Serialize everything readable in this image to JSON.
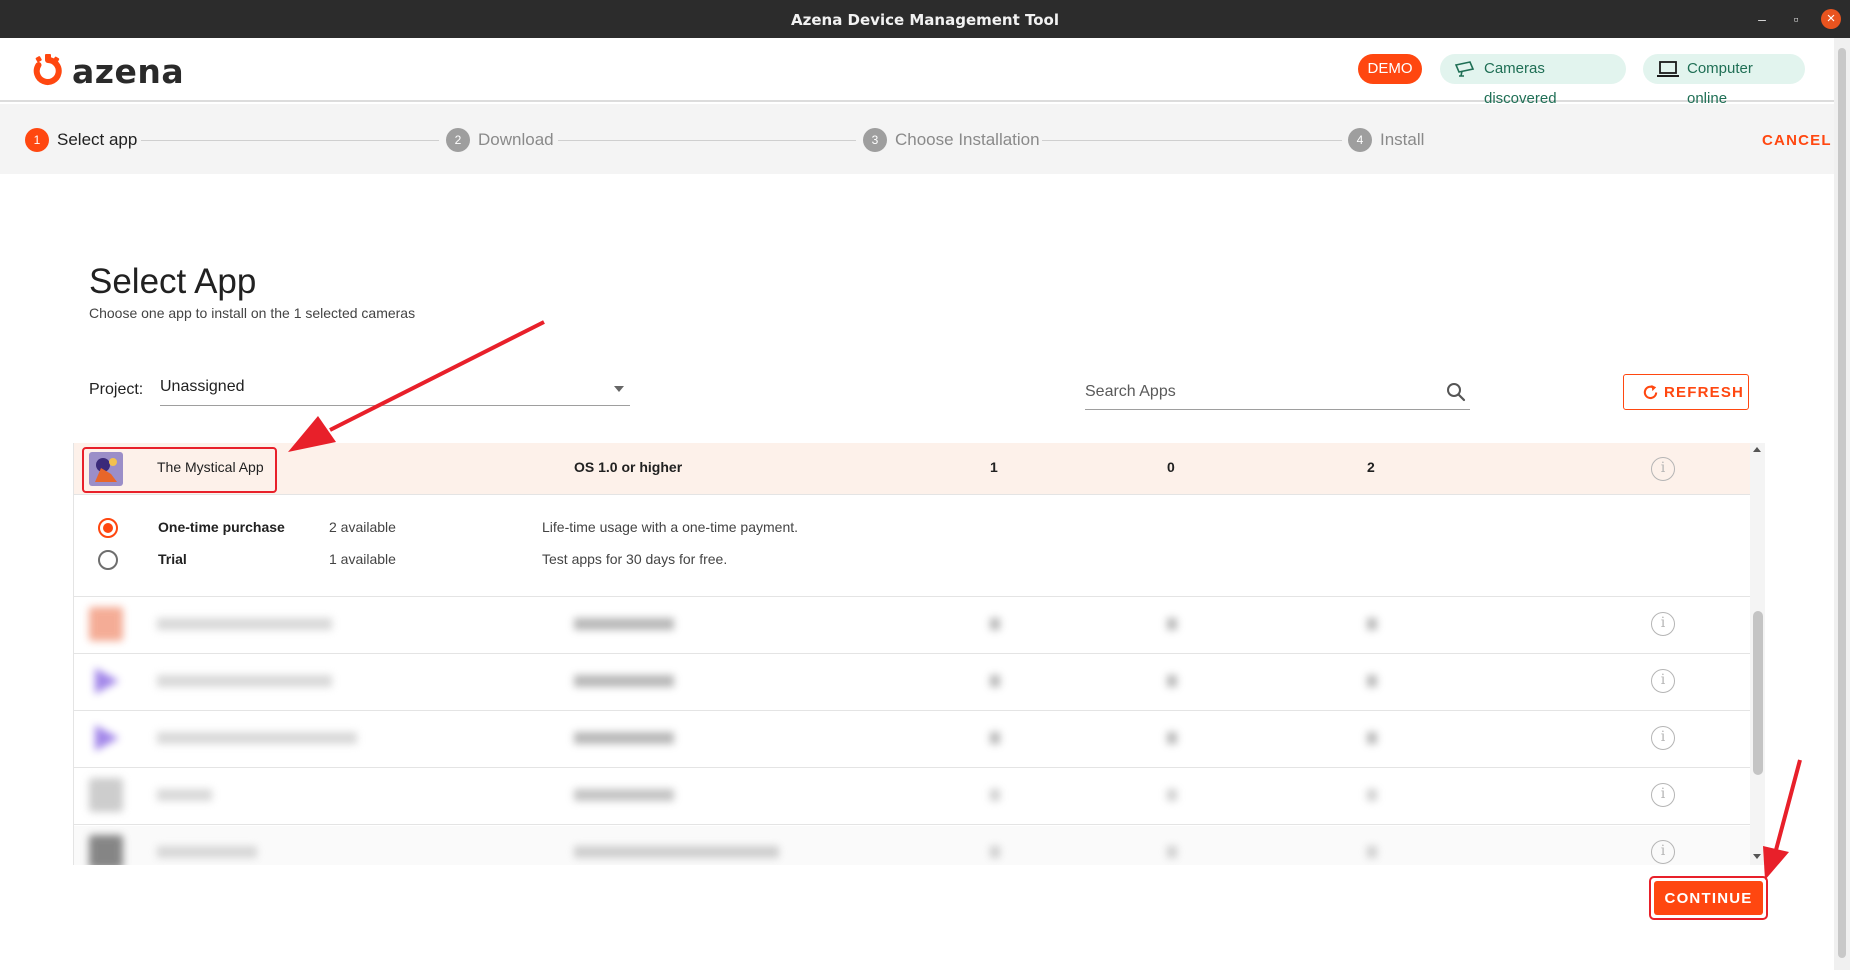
{
  "window": {
    "title": "Azena Device Management Tool"
  },
  "header": {
    "logo_text": "azena",
    "demo_label": "DEMO",
    "cameras_status": "Cameras discovered",
    "computer_status": "Computer online"
  },
  "stepper": {
    "steps": [
      {
        "num": "1",
        "label": "Select app"
      },
      {
        "num": "2",
        "label": "Download"
      },
      {
        "num": "3",
        "label": "Choose Installation"
      },
      {
        "num": "4",
        "label": "Install"
      }
    ],
    "current_step": 1,
    "cancel_label": "CANCEL"
  },
  "main": {
    "title": "Select App",
    "subtitle": "Choose one app to install on the 1 selected cameras",
    "project_label": "Project:",
    "project_value": "Unassigned",
    "search_placeholder": "Search Apps",
    "refresh_label": "REFRESH",
    "continue_label": "CONTINUE"
  },
  "apps": {
    "selected": {
      "name": "The Mystical App",
      "os": "OS 1.0 or higher",
      "col1": "1",
      "col2": "0",
      "col3": "2"
    },
    "licenses": [
      {
        "type": "One-time purchase",
        "available": "2 available",
        "description": "Life-time usage with a one-time payment.",
        "selected": true
      },
      {
        "type": "Trial",
        "available": "1 available",
        "description": "Test apps for 30 days for free.",
        "selected": false
      }
    ],
    "blurred_rows": 5
  },
  "colors": {
    "accent": "#ff4710",
    "status_bg": "#e2f4ee",
    "status_text": "#1f6f55",
    "annotation_red": "#e8202a"
  }
}
